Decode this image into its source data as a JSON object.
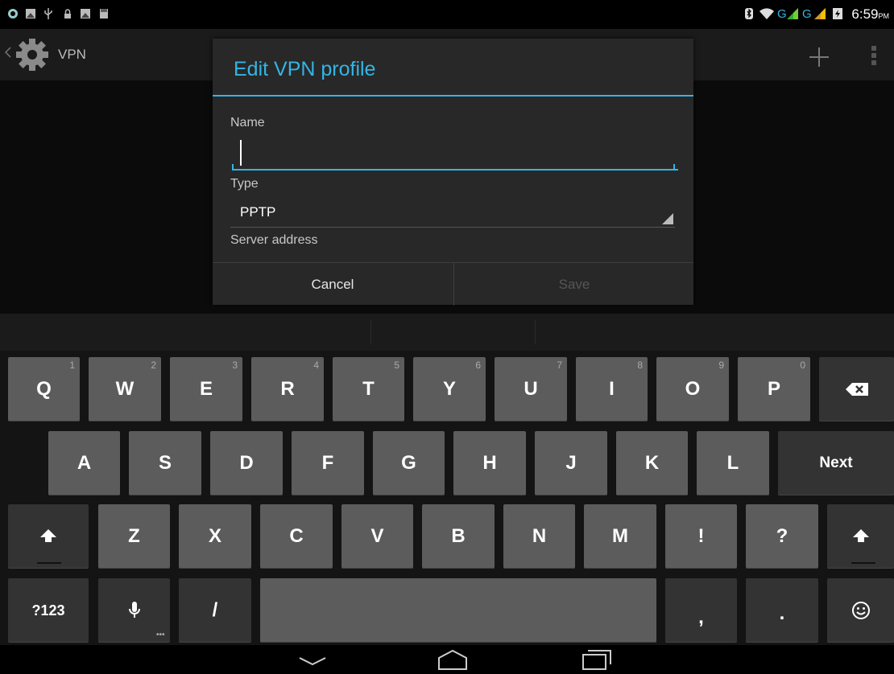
{
  "status_bar": {
    "time": "6:59",
    "ampm": "PM",
    "network1": "G",
    "network2": "G"
  },
  "action_bar": {
    "title": "VPN"
  },
  "dialog": {
    "title": "Edit VPN profile",
    "name_label": "Name",
    "name_value": "",
    "type_label": "Type",
    "type_value": "PPTP",
    "server_label": "Server address",
    "cancel": "Cancel",
    "save": "Save"
  },
  "keyboard": {
    "row1": [
      {
        "k": "Q",
        "h": "1"
      },
      {
        "k": "W",
        "h": "2"
      },
      {
        "k": "E",
        "h": "3"
      },
      {
        "k": "R",
        "h": "4"
      },
      {
        "k": "T",
        "h": "5"
      },
      {
        "k": "Y",
        "h": "6"
      },
      {
        "k": "U",
        "h": "7"
      },
      {
        "k": "I",
        "h": "8"
      },
      {
        "k": "O",
        "h": "9"
      },
      {
        "k": "P",
        "h": "0"
      }
    ],
    "row2": [
      "A",
      "S",
      "D",
      "F",
      "G",
      "H",
      "J",
      "K",
      "L"
    ],
    "next": "Next",
    "row3": [
      "Z",
      "X",
      "C",
      "V",
      "B",
      "N",
      "M",
      "!",
      "?"
    ],
    "sym": "?123",
    "slash": "/",
    "comma": ",",
    "period": "."
  },
  "colors": {
    "accent": "#33b5e5",
    "key": "#5c5c5c",
    "key_dark": "#333333"
  }
}
